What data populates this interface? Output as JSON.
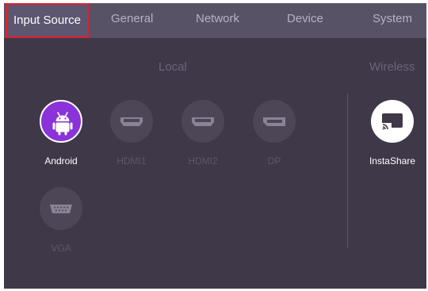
{
  "tabs": [
    {
      "label": "Input Source",
      "active": true
    },
    {
      "label": "General"
    },
    {
      "label": "Network"
    },
    {
      "label": "Device"
    },
    {
      "label": "System"
    }
  ],
  "sections": {
    "local": "Local",
    "wireless": "Wireless"
  },
  "sources": [
    {
      "label": "Android",
      "icon": "android-icon",
      "selected": true
    },
    {
      "label": "HDMI1",
      "icon": "hdmi-icon"
    },
    {
      "label": "HDMI2",
      "icon": "hdmi-icon"
    },
    {
      "label": "DP",
      "icon": "displayport-icon"
    },
    {
      "label": "VGA",
      "icon": "vga-icon"
    },
    {
      "label": "InstaShare",
      "icon": "cast-icon"
    }
  ],
  "colors": {
    "accent": "#8a33d9",
    "tab_highlight": "#e2202a",
    "background": "#3f3848",
    "tabbar": "#585266"
  }
}
